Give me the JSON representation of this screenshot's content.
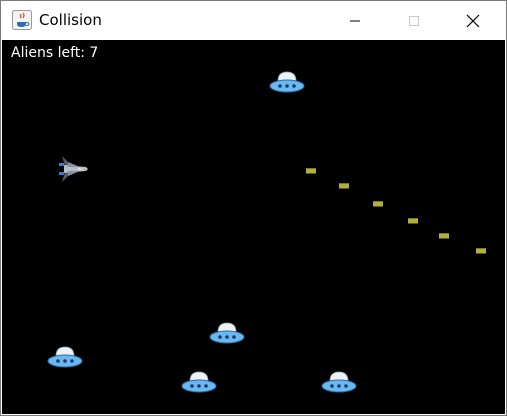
{
  "window": {
    "title": "Collision",
    "controls": {
      "minimize": "minimize",
      "maximize": "maximize",
      "close": "close"
    }
  },
  "hud": {
    "aliens_left": "Aliens left: 7"
  },
  "sprites": {
    "player": "spaceship-icon",
    "alien": "ufo-icon",
    "missile": "missile-icon"
  },
  "colors": {
    "canvas_bg": "#000000",
    "hud_text": "#ffffff",
    "missile": "#b0b040",
    "ufo_body": "#6ab8f0",
    "ufo_dome": "#e8eef2"
  }
}
